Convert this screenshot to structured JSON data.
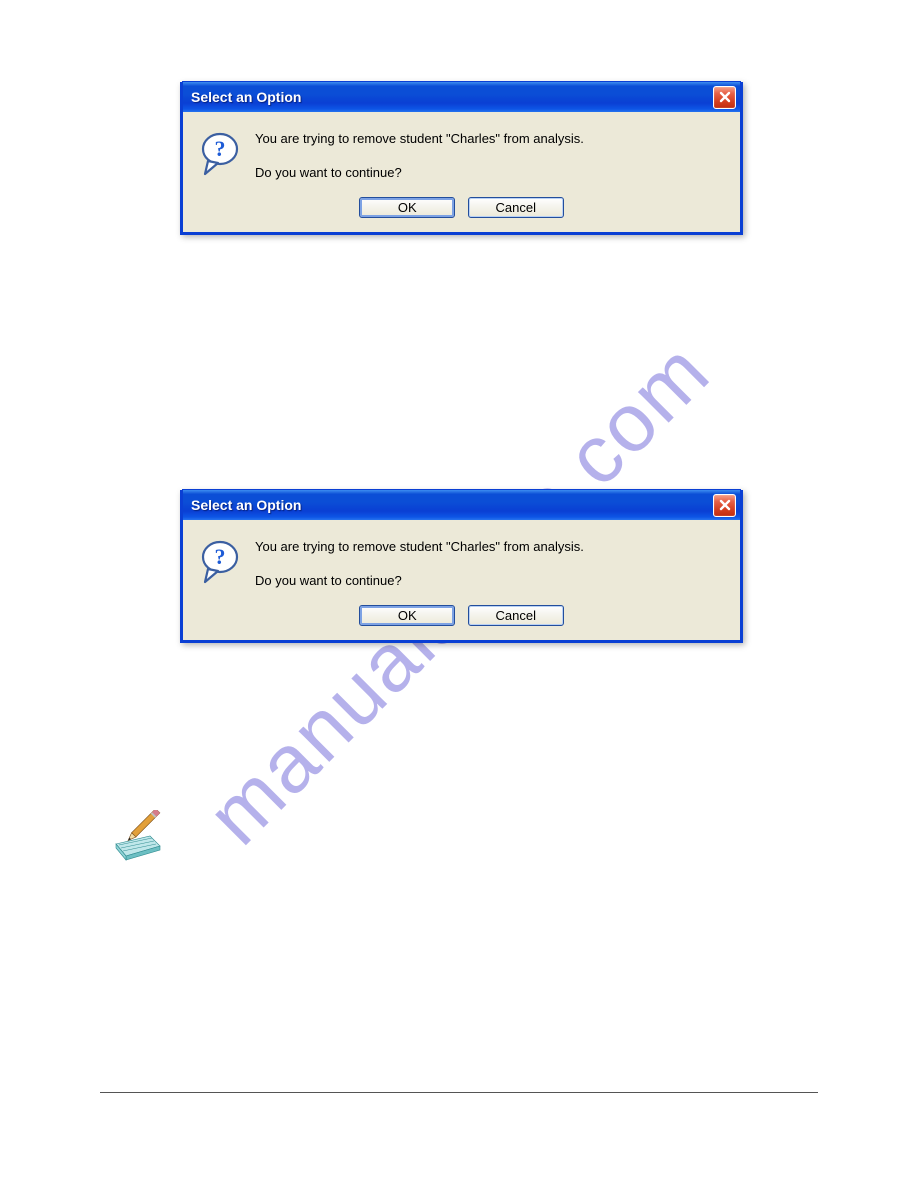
{
  "watermark_text": "manualshive.com",
  "dialog1": {
    "title": "Select an Option",
    "message_line1": "You are trying to remove student \"Charles\" from analysis.",
    "message_line2": "Do you want to continue?",
    "ok_label": "OK",
    "cancel_label": "Cancel"
  },
  "dialog2": {
    "title": "Select an Option",
    "message_line1": "You are trying to remove student \"Charles\" from analysis.",
    "message_line2": "Do you want to continue?",
    "ok_label": "OK",
    "cancel_label": "Cancel"
  }
}
